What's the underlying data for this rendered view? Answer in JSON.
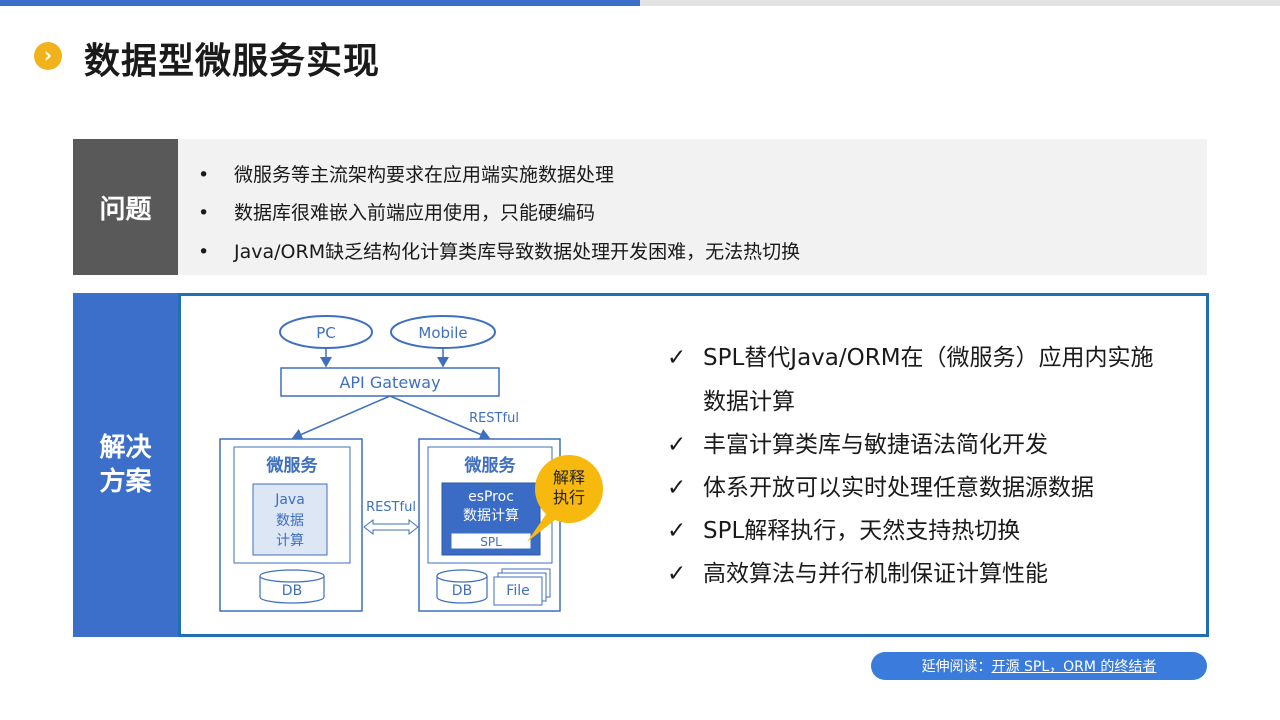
{
  "page": {
    "title": "数据型微服务实现",
    "title_bullet": "›"
  },
  "problem": {
    "label": "问题",
    "items": [
      "微服务等主流架构要求在应用端实施数据处理",
      "数据库很难嵌入前端应用使用，只能硬编码",
      "Java/ORM缺乏结构化计算类库导致数据处理开发困难，无法热切换"
    ],
    "bullet": "•"
  },
  "solution": {
    "label_line1": "解决",
    "label_line2": "方案",
    "check": "✓",
    "benefits": [
      "SPL替代Java/ORM在（微服务）应用内实施",
      "丰富计算类库与敏捷语法简化开发",
      "体系开放可以实时处理任意数据源数据",
      "SPL解释执行，天然支持热切换",
      "高效算法与并行机制保证计算性能"
    ],
    "benefit_cont": "数据计算"
  },
  "diagram": {
    "pc": "PC",
    "mobile": "Mobile",
    "gateway": "API Gateway",
    "restful_top": "RESTful",
    "restful_mid": "RESTful",
    "ms_left_title": "微服务",
    "ms_right_title": "微服务",
    "java_l1": "Java",
    "java_l2": "数据",
    "java_l3": "计算",
    "esproc_l1": "esProc",
    "esproc_l2": "数据计算",
    "spl": "SPL",
    "db_left": "DB",
    "db_right": "DB",
    "file": "File",
    "callout_l1": "解释",
    "callout_l2": "执行"
  },
  "footer": {
    "prefix": "延伸阅读：",
    "link": "开源 SPL，ORM 的终结者"
  },
  "colors": {
    "accent_blue": "#3b6fc9",
    "diagram_blue": "#3f6fbf",
    "gold": "#f2b21c",
    "dark_gray": "#595959"
  }
}
